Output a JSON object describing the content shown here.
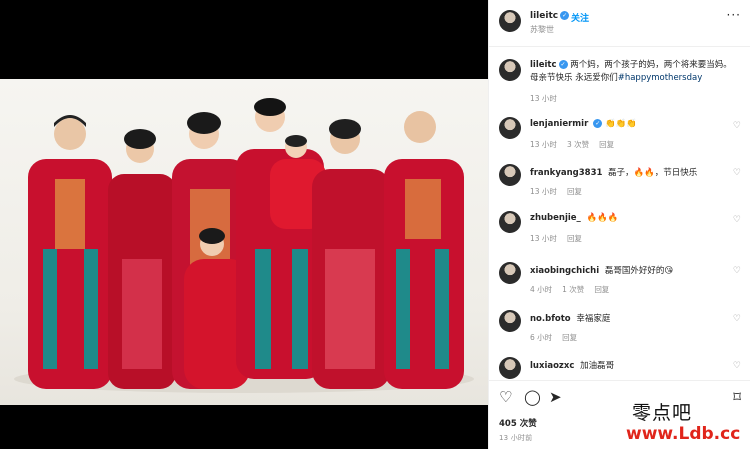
{
  "post": {
    "username": "lileitc",
    "follow_label": "关注",
    "location": "苏黎世",
    "caption_line1": "两个妈，两个孩子的妈，两个将来要当妈。",
    "caption_line2": "母亲节快乐 永远爱你们",
    "hashtag": "#happymothersday",
    "caption_time": "13 小时",
    "likes": "405 次赞",
    "post_time": "13 小时前"
  },
  "comments": [
    {
      "user": "lenjaniermir",
      "verified": true,
      "text": "👏👏👏",
      "time": "13 小时",
      "likes": "3 次赞",
      "reply": "回复"
    },
    {
      "user": "frankyang3831",
      "verified": false,
      "text": "磊子，🔥🔥，节日快乐",
      "time": "13 小时",
      "likes": "",
      "reply": "回复"
    },
    {
      "user": "zhubenjie_",
      "verified": false,
      "text": "🔥🔥🔥",
      "time": "13 小时",
      "likes": "",
      "reply": "回复"
    },
    {
      "user": "xiaobingchichi",
      "verified": false,
      "text": "磊哥国外好好的😘",
      "time": "4 小时",
      "likes": "1 次赞",
      "reply": "回复"
    },
    {
      "user": "no.bfoto",
      "verified": false,
      "text": "幸福家庭",
      "time": "6 小时",
      "likes": "",
      "reply": "回复"
    },
    {
      "user": "luxiaozxc",
      "verified": false,
      "text": "加油磊哥",
      "time": "",
      "likes": "",
      "reply": ""
    }
  ],
  "icons": [
    "heart-icon",
    "comment-icon",
    "share-icon",
    "bookmark-icon",
    "more-icon",
    "verified-icon"
  ],
  "watermark": {
    "line1": "零点吧",
    "line2": "www.Ldb.cc"
  },
  "colors": {
    "accent": "#0095f6",
    "hashtag": "#00376b",
    "muted": "#8e8e8e",
    "outfit_red": "#c8102e"
  }
}
